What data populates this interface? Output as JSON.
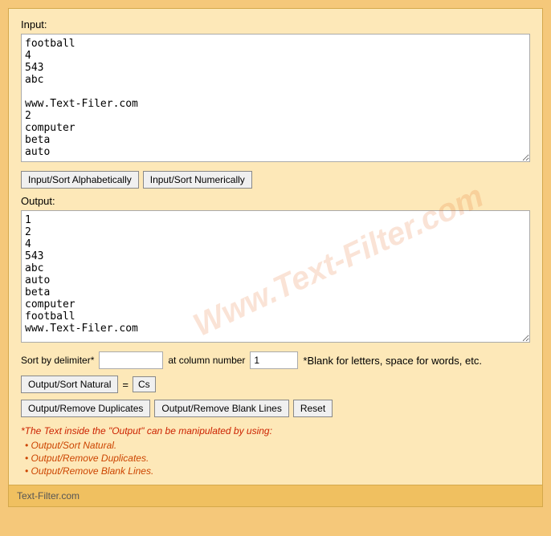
{
  "header": {
    "input_label": "Input:",
    "output_label": "Output:"
  },
  "watermark": "Www.Text-Filter.com",
  "input": {
    "value": "football\n4\n543\nabc\n\nwww.Text-Filer.com\n2\ncomputer\nbeta\nauto"
  },
  "output": {
    "value": "1\n2\n4\n543\nabc\nauto\nbeta\ncomputer\nfootball\nwww.Text-Filer.com"
  },
  "buttons": {
    "sort_alpha": "Input/Sort Alphabetically",
    "sort_numeric": "Input/Sort Numerically",
    "sort_natural": "Output/Sort Natural",
    "cs_label": "Cs",
    "remove_duplicates": "Output/Remove Duplicates",
    "remove_blank": "Output/Remove Blank Lines",
    "reset": "Reset"
  },
  "sort_controls": {
    "delimiter_label": "Sort by delimiter*",
    "delimiter_placeholder": "",
    "column_label": "at column number",
    "column_value": "1",
    "hint": "*Blank for letters, space for words, etc.",
    "equals": "="
  },
  "info": {
    "title": "*The Text inside the \"Output\" can be manipulated by using:",
    "items": [
      "Output/Sort Natural.",
      "Output/Remove Duplicates.",
      "Output/Remove Blank Lines."
    ]
  },
  "footer": {
    "text": "Text-Filter.com"
  }
}
